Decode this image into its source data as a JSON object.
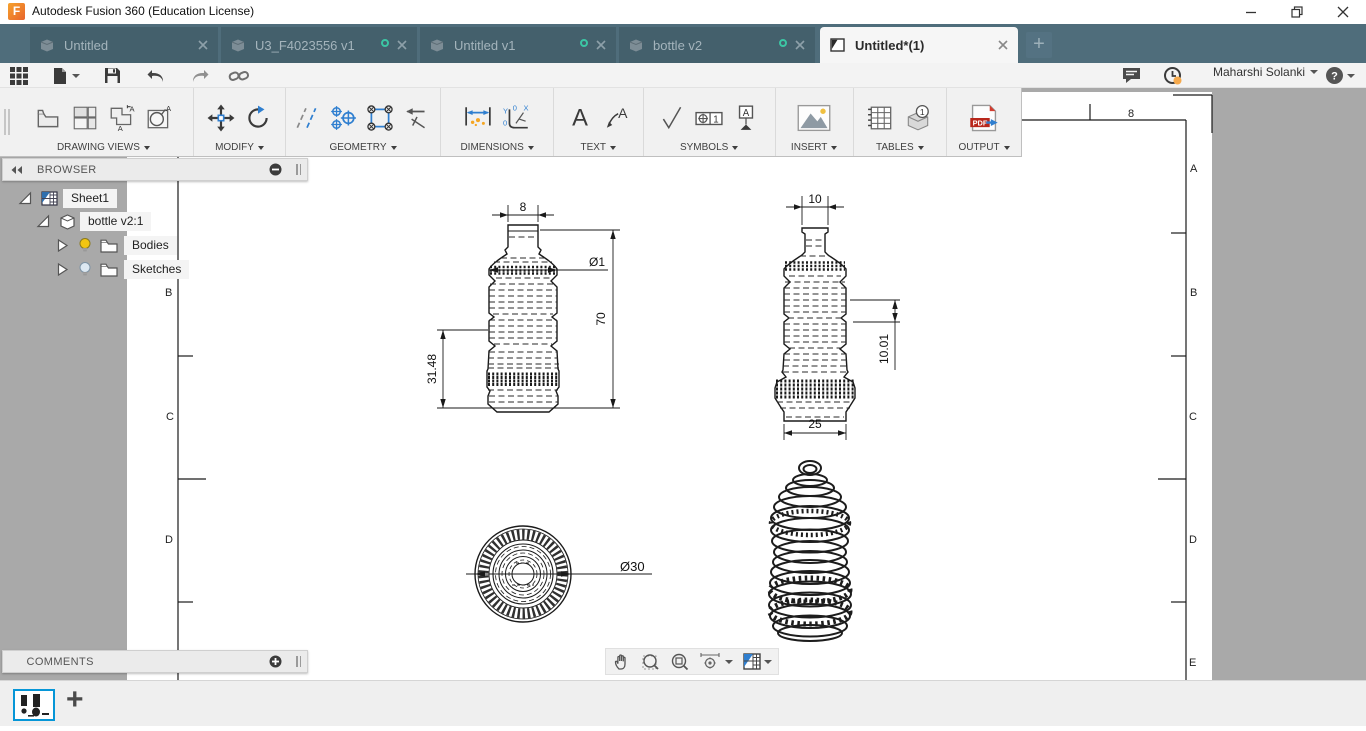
{
  "window": {
    "title": "Autodesk Fusion 360 (Education License)",
    "logo_glyph": "F"
  },
  "tabs": {
    "items": [
      {
        "label": "Untitled",
        "active": false,
        "status_dot": false
      },
      {
        "label": "U3_F4023556 v1",
        "active": false,
        "status_dot": true
      },
      {
        "label": "Untitled v1",
        "active": false,
        "status_dot": true
      },
      {
        "label": "bottle v2",
        "active": false,
        "status_dot": true
      },
      {
        "label": "Untitled*(1)",
        "active": true,
        "status_dot": false
      }
    ],
    "new_tab_glyph": "+"
  },
  "header": {
    "user_name": "Maharshi Solanki",
    "help_glyph": "?"
  },
  "ribbon": {
    "groups": [
      "DRAWING VIEWS",
      "MODIFY",
      "GEOMETRY",
      "DIMENSIONS",
      "TEXT",
      "SYMBOLS",
      "INSERT",
      "TABLES",
      "OUTPUT"
    ],
    "icon_labels": {
      "text": "A",
      "leader": "A",
      "datum": "A",
      "fcf_number": "1",
      "balloon_number": "1",
      "pdf": "PDF",
      "ordinate_x": "X",
      "ordinate_y": "Y",
      "ordinate_zero": "0"
    }
  },
  "browser": {
    "title": "BROWSER",
    "items": [
      {
        "label": "Sheet1"
      },
      {
        "label": "bottle v2:1"
      },
      {
        "label": "Bodies",
        "bulb": "on"
      },
      {
        "label": "Sketches",
        "bulb": "off"
      }
    ]
  },
  "comments": {
    "title": "COMMENTS"
  },
  "sheet": {
    "zone_number_top": "8",
    "zones_right": [
      "A",
      "B",
      "C",
      "D",
      "E"
    ],
    "zones_left": [
      "B",
      "C",
      "D"
    ]
  },
  "drawing": {
    "front_view_left": {
      "neck_width": "8",
      "rib_diameter": "Ø1",
      "total_height": "70",
      "lower_height": "31.48"
    },
    "front_view_right": {
      "neck_width": "10",
      "band_height": "10.01",
      "base_width": "25"
    },
    "bottom_view": {
      "outer_diameter": "Ø30"
    }
  },
  "bottom_bar": {
    "add_sheet_glyph": "+"
  },
  "colors": {
    "accent_blue": "#0696d7",
    "tabbar_slate": "#4f6d7b",
    "status_green": "#3cc6a4",
    "bulb_on": "#f2c511",
    "canvas_gray": "#a9a9a9"
  }
}
